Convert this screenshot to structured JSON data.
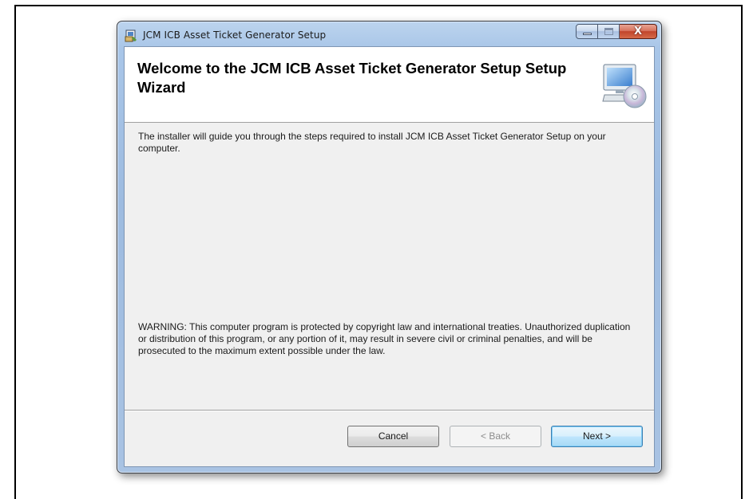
{
  "window": {
    "title": "JCM ICB Asset Ticket Generator Setup",
    "close_glyph": "X"
  },
  "banner": {
    "title": "Welcome to the JCM ICB Asset Ticket Generator Setup Setup Wizard",
    "icon": "computer-cd-icon"
  },
  "content": {
    "intro": "The installer will guide you through the steps required to install JCM ICB Asset Ticket Generator Setup on your computer.",
    "warning": "WARNING: This computer program is protected by copyright law and international treaties. Unauthorized duplication or distribution of this program, or any portion of it, may result in severe civil or criminal penalties, and will be prosecuted to the maximum extent possible under the law."
  },
  "buttons": {
    "cancel": "Cancel",
    "back": "< Back",
    "next": "Next >"
  },
  "colors": {
    "close_button": "#c1442b",
    "next_button_border": "#3c7fb1",
    "client_background": "#f0f0f0"
  }
}
